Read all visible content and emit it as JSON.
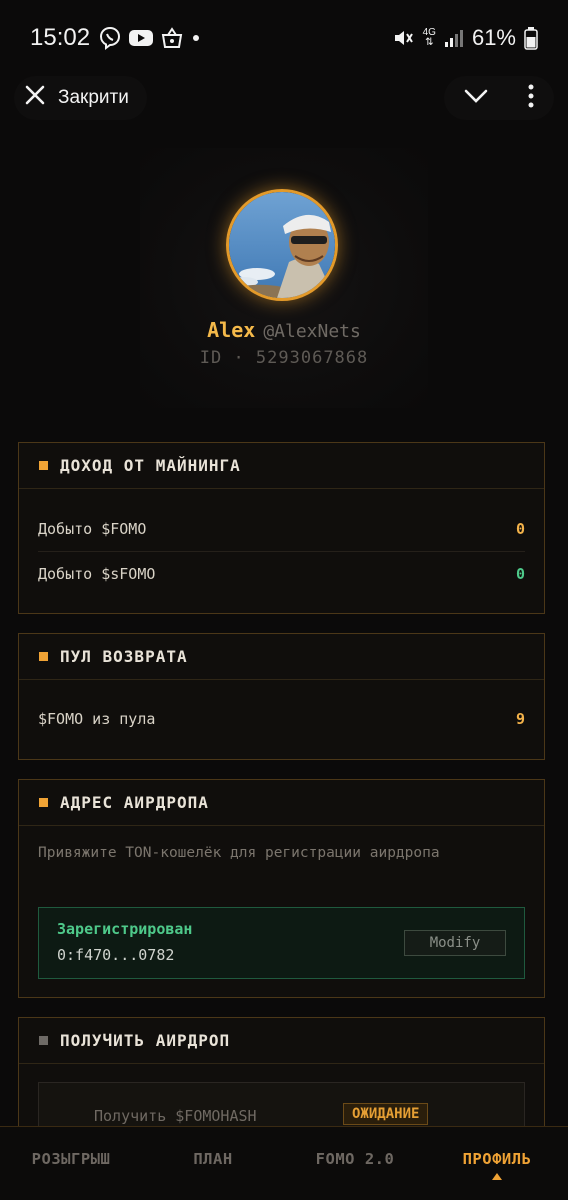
{
  "status_bar": {
    "time": "15:02",
    "battery": "61%",
    "network": "4G",
    "icons_left": [
      "viber-icon",
      "youtube-icon",
      "shop-icon",
      "dot-icon"
    ],
    "icons_right": [
      "mute-icon",
      "network-icon",
      "signal-icon",
      "battery-icon"
    ]
  },
  "topbar": {
    "close_label": "Закрити"
  },
  "profile": {
    "name": "Alex",
    "handle": "@AlexNets",
    "id_line": "ID · 5293067868"
  },
  "mining": {
    "title": "ДОХОД ОТ МАЙНИНГА",
    "rows": [
      {
        "label": "Добыто $FOMO",
        "value": "0"
      },
      {
        "label": "Добыто $sFOMO",
        "value": "0"
      }
    ]
  },
  "refund": {
    "title": "ПУЛ ВОЗВРАТА",
    "rows": [
      {
        "label": "$FOMO из пула",
        "value": "9"
      }
    ]
  },
  "airdrop_address": {
    "title": "АДРЕС АИРДРОПА",
    "hint": "Привяжите TON-кошелёк для регистрации аирдропа",
    "status": "Зарегистрирован",
    "address": "0:f470...0782",
    "modify_label": "Modify"
  },
  "claim": {
    "title": "ПОЛУЧИТЬ АИРДРОП",
    "label": "Получить $FOMOHASH",
    "badge": "ОЖИДАНИЕ"
  },
  "nav": {
    "items": [
      "РОЗЫГРЫШ",
      "ПЛАН",
      "FOMO 2.0",
      "ПРОФИЛЬ"
    ],
    "active_index": 3
  },
  "colors": {
    "accent": "#f0a335",
    "green": "#4ec98a",
    "background": "#0b0a0a",
    "card_border": "#4b3718"
  }
}
